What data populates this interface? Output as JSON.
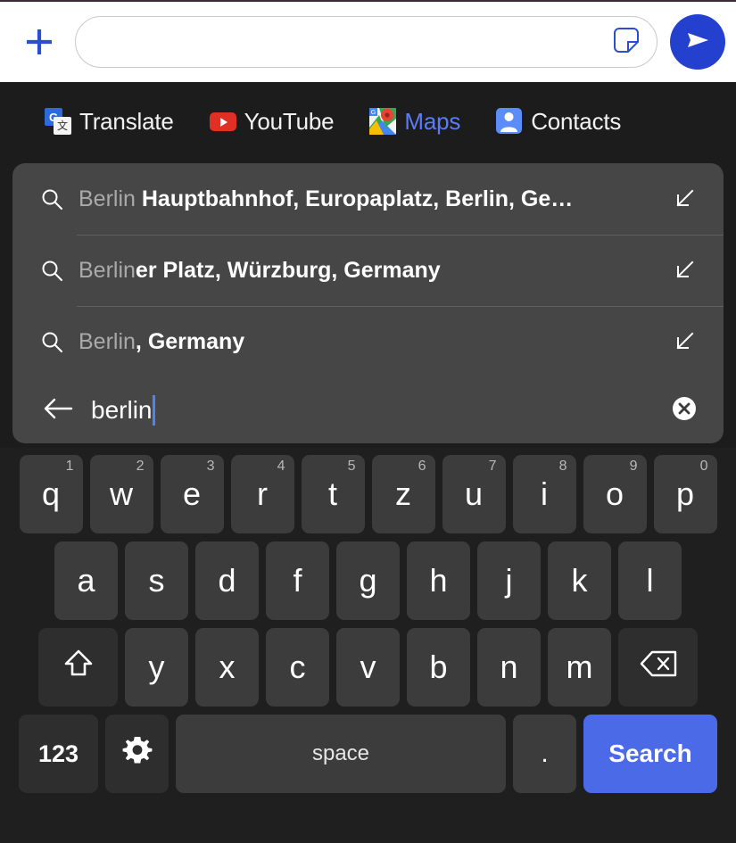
{
  "compose": {
    "add_icon": "plus-icon",
    "input_value": "",
    "input_placeholder": "",
    "sticker_icon": "sticker-icon",
    "send_icon": "send-icon",
    "accent_color": "#2440cf"
  },
  "app_strip": {
    "items": [
      {
        "label": "Translate",
        "icon": "google-translate-icon",
        "active": false
      },
      {
        "label": "YouTube",
        "icon": "youtube-icon",
        "active": false
      },
      {
        "label": "Maps",
        "icon": "google-maps-icon",
        "active": true
      },
      {
        "label": "Contacts",
        "icon": "contacts-icon",
        "active": false
      }
    ],
    "active_color": "#5b7cf5"
  },
  "suggestions": {
    "search_icon": "search-icon",
    "insert_icon": "arrow-down-left-icon",
    "items": [
      {
        "match": "Berlin ",
        "rest": "Hauptbahnhof, Europaplatz, Berlin, Ge…"
      },
      {
        "match": "Berlin",
        "rest": "er Platz, Würzburg, Germany"
      },
      {
        "match": "Berlin",
        "rest": ", Germany"
      }
    ]
  },
  "search_bar": {
    "back_icon": "back-arrow-icon",
    "value": "berlin",
    "clear_icon": "clear-icon"
  },
  "keyboard": {
    "layout": "qwertz-de",
    "row1": [
      {
        "key": "q",
        "num": "1"
      },
      {
        "key": "w",
        "num": "2"
      },
      {
        "key": "e",
        "num": "3"
      },
      {
        "key": "r",
        "num": "4"
      },
      {
        "key": "t",
        "num": "5"
      },
      {
        "key": "z",
        "num": "6"
      },
      {
        "key": "u",
        "num": "7"
      },
      {
        "key": "i",
        "num": "8"
      },
      {
        "key": "o",
        "num": "9"
      },
      {
        "key": "p",
        "num": "0"
      }
    ],
    "row2": [
      {
        "key": "a"
      },
      {
        "key": "s"
      },
      {
        "key": "d"
      },
      {
        "key": "f"
      },
      {
        "key": "g"
      },
      {
        "key": "h"
      },
      {
        "key": "j"
      },
      {
        "key": "k"
      },
      {
        "key": "l"
      }
    ],
    "row3": {
      "shift_icon": "shift-icon",
      "letters": [
        {
          "key": "y"
        },
        {
          "key": "x"
        },
        {
          "key": "c"
        },
        {
          "key": "v"
        },
        {
          "key": "b"
        },
        {
          "key": "n"
        },
        {
          "key": "m"
        }
      ],
      "backspace_icon": "backspace-icon"
    },
    "row4": {
      "numeric_label": "123",
      "settings_icon": "gear-icon",
      "space_label": "space",
      "period_label": ".",
      "enter_label": "Search",
      "enter_color": "#4a6ae8"
    }
  }
}
